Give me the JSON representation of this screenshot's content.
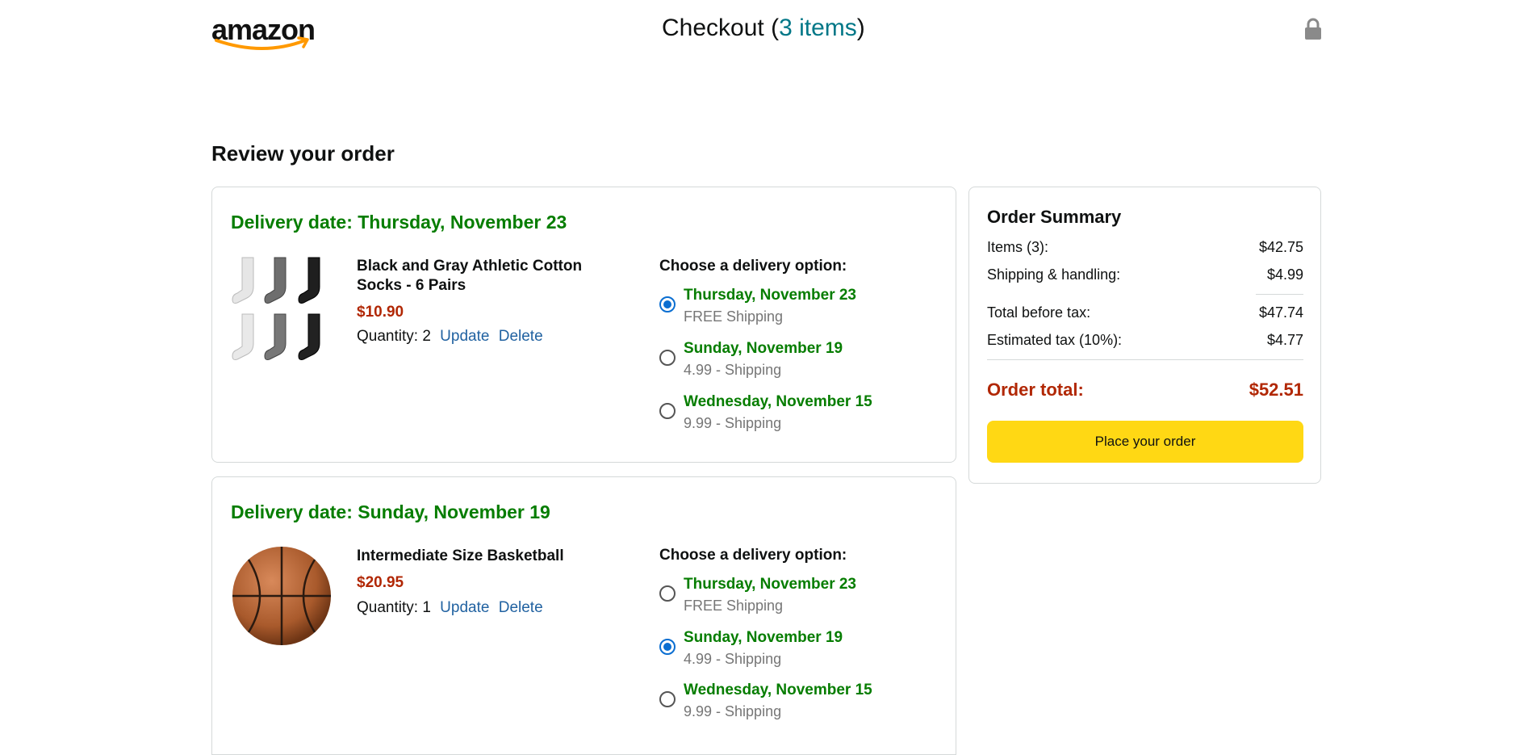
{
  "header": {
    "logo_text": "amazon",
    "title_prefix": "Checkout (",
    "items_link": "3 items",
    "title_suffix": ")"
  },
  "page_heading": "Review your order",
  "orders": [
    {
      "delivery_date": "Delivery date: Thursday, November 23",
      "product_name": "Black and Gray Athletic Cotton Socks - 6 Pairs",
      "price": "$10.90",
      "quantity_label": "Quantity: 2",
      "update_label": "Update",
      "delete_label": "Delete",
      "choose_label": "Choose a delivery option:",
      "options": [
        {
          "date": "Thursday, November 23",
          "shipping": "FREE Shipping",
          "selected": true
        },
        {
          "date": "Sunday, November 19",
          "shipping": "4.99 - Shipping",
          "selected": false
        },
        {
          "date": "Wednesday, November 15",
          "shipping": "9.99 - Shipping",
          "selected": false
        }
      ]
    },
    {
      "delivery_date": "Delivery date: Sunday, November 19",
      "product_name": "Intermediate Size Basketball",
      "price": "$20.95",
      "quantity_label": "Quantity: 1",
      "update_label": "Update",
      "delete_label": "Delete",
      "choose_label": "Choose a delivery option:",
      "options": [
        {
          "date": "Thursday, November 23",
          "shipping": "FREE Shipping",
          "selected": false
        },
        {
          "date": "Sunday, November 19",
          "shipping": "4.99 - Shipping",
          "selected": true
        },
        {
          "date": "Wednesday, November 15",
          "shipping": "9.99 - Shipping",
          "selected": false
        }
      ]
    }
  ],
  "summary": {
    "title": "Order Summary",
    "items_label": "Items (3):",
    "items_value": "$42.75",
    "shipping_label": "Shipping & handling:",
    "shipping_value": "$4.99",
    "before_tax_label": "Total before tax:",
    "before_tax_value": "$47.74",
    "tax_label": "Estimated tax (10%):",
    "tax_value": "$4.77",
    "total_label": "Order total:",
    "total_value": "$52.51",
    "place_order_label": "Place your order"
  },
  "colors": {
    "delivery_green": "#067d00",
    "price_red": "#b12704",
    "link_blue": "#2162a1",
    "items_teal": "#017787",
    "button_yellow": "#ffd814"
  },
  "icons": [
    "amazon-logo",
    "lock-icon",
    "radio-button"
  ]
}
